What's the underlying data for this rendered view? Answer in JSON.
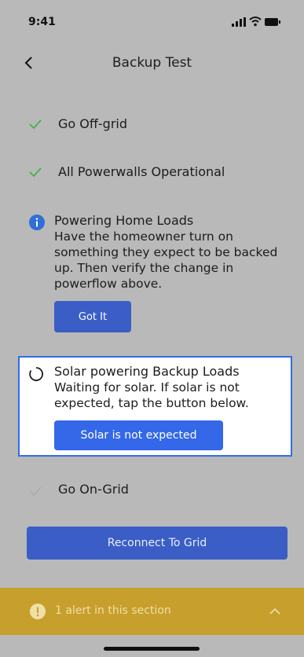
{
  "status_bar": {
    "time": "9:41"
  },
  "nav": {
    "title": "Backup Test"
  },
  "steps": [
    {
      "title": "Go Off-grid",
      "status": "done"
    },
    {
      "title": "All Powerwalls Operational",
      "status": "done"
    },
    {
      "title": "Powering Home Loads",
      "status": "info",
      "description": "Have the homeowner turn on something they expect to be backed up. Then verify the change in powerflow above.",
      "button_label": "Got It"
    },
    {
      "title": "Solar powering Backup Loads",
      "status": "in-progress",
      "description": "Waiting for solar. If solar is not expected, tap the button below.",
      "button_label": "Solar is not expected"
    },
    {
      "title": "Go On-Grid",
      "status": "pending"
    }
  ],
  "reconnect_button": {
    "label": "Reconnect To Grid"
  },
  "alert_bar": {
    "text": "1 alert in this section"
  },
  "colors": {
    "check_green": "#3fb34a",
    "info_blue": "#2f6fd6",
    "button_blue": "#3a5ec5",
    "highlight_border": "#2f6ee8",
    "alert_bar": "#c79f2c"
  }
}
